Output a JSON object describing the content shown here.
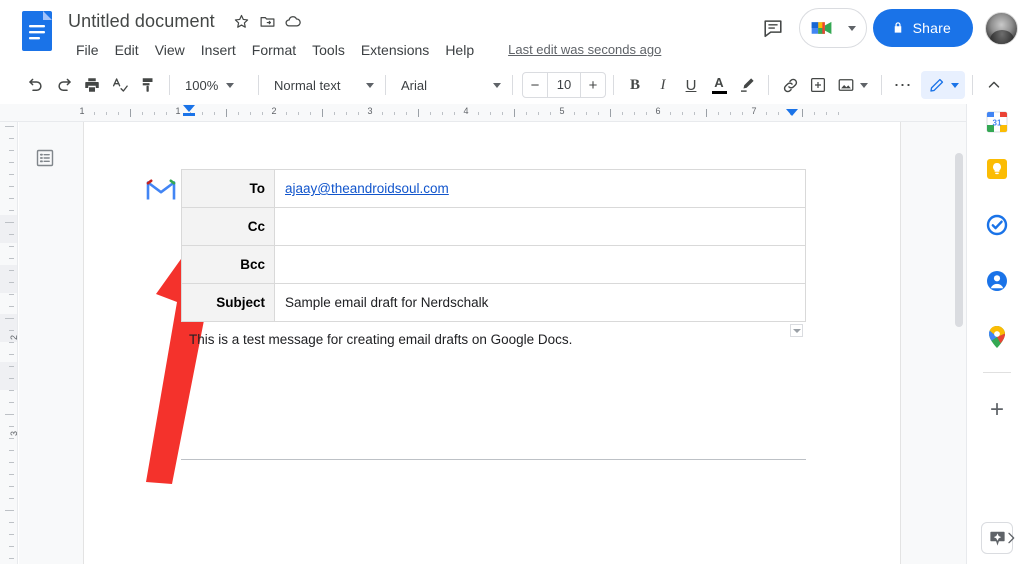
{
  "header": {
    "doc_title": "Untitled document",
    "icons": {
      "docs_logo": "google-docs-logo",
      "star": "star-icon",
      "move_to_folder": "move-to-folder-icon",
      "cloud_status": "cloud-saved-icon",
      "comment_history": "comment-history-icon",
      "meet": "google-meet-icon",
      "lock": "lock-icon"
    },
    "menu": [
      "File",
      "Edit",
      "View",
      "Insert",
      "Format",
      "Tools",
      "Extensions",
      "Help"
    ],
    "last_edit": "Last edit was seconds ago",
    "share_label": "Share",
    "avatar": "user-avatar"
  },
  "toolbar": {
    "undo": "undo-icon",
    "redo": "redo-icon",
    "print": "print-icon",
    "spellcheck": "spellcheck-icon",
    "paint_format": "paint-format-icon",
    "zoom_value": "100%",
    "style_value": "Normal text",
    "font_value": "Arial",
    "font_size_value": "10",
    "decrease_label": "−",
    "increase_label": "+",
    "bold": "B",
    "italic": "I",
    "underline": "U",
    "text_color": "A",
    "highlight": "highlight-pen-icon",
    "insert_link": "link-icon",
    "add_comment": "add-comment-icon",
    "insert_image": "insert-image-icon",
    "more": "⋯",
    "editing_mode": "pencil-edit-icon",
    "collapse": "collapse-toolbar-icon"
  },
  "ruler": {
    "numbers": [
      "1",
      "1",
      "2",
      "3",
      "4",
      "5",
      "6",
      "7"
    ],
    "left_indent": "left-indent-marker",
    "right_indent": "right-indent-marker"
  },
  "vruler": {
    "numbers": [
      "2",
      "3"
    ]
  },
  "document": {
    "outline_toggle": "document-outline-icon",
    "gmail_icon": "gmail-logo-icon",
    "annotation_arrow": "red-arrow-annotation",
    "email": {
      "rows": [
        {
          "label": "To",
          "value": "ajaay@theandroidsoul.com",
          "is_link": true
        },
        {
          "label": "Cc",
          "value": "",
          "is_link": false
        },
        {
          "label": "Bcc",
          "value": "",
          "is_link": false
        },
        {
          "label": "Subject",
          "value": "Sample email draft for Nerdschalk",
          "is_link": false
        }
      ]
    },
    "body_text": "This is a test message for creating email drafts on Google Docs.",
    "table_handle": "table-options-handle"
  },
  "side_panel": {
    "items": [
      {
        "name": "google-calendar-icon",
        "label": "31"
      },
      {
        "name": "google-keep-icon",
        "label": ""
      },
      {
        "name": "google-tasks-icon",
        "label": ""
      },
      {
        "name": "google-contacts-icon",
        "label": ""
      },
      {
        "name": "google-maps-icon",
        "label": ""
      }
    ],
    "add_ons_label": "+",
    "explore_icon": "explore-sparkle-icon",
    "expand_icon": "expand-panel-chevron-icon"
  },
  "colors": {
    "accent_blue": "#1a73e8",
    "link_blue": "#1155cc",
    "annotation_red": "#f4322c",
    "header_gray": "#444746",
    "table_header_bg": "#f3f3f3"
  }
}
